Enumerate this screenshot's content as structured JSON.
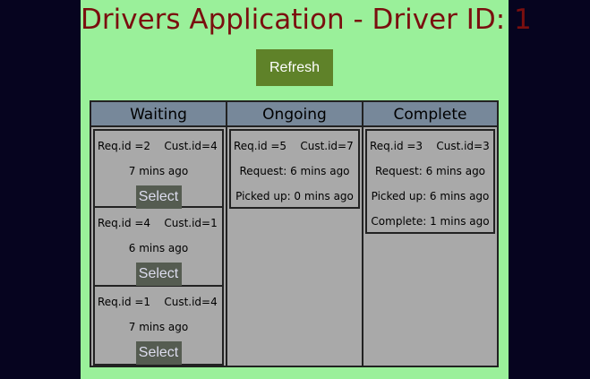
{
  "app": {
    "title": "Drivers Application - Driver ID: 1",
    "refresh_label": "Refresh"
  },
  "columns": {
    "waiting": {
      "header": "Waiting",
      "cards": [
        {
          "req": "Req.id =2",
          "cust": "Cust.id=4",
          "time": "7 mins ago",
          "select_label": "Select"
        },
        {
          "req": "Req.id =4",
          "cust": "Cust.id=1",
          "time": "6 mins ago",
          "select_label": "Select"
        },
        {
          "req": "Req.id =1",
          "cust": "Cust.id=4",
          "time": "7 mins ago",
          "select_label": "Select"
        }
      ]
    },
    "ongoing": {
      "header": "Ongoing",
      "cards": [
        {
          "req": "Req.id =5",
          "cust": "Cust.id=7",
          "request": "Request: 6 mins ago",
          "picked": "Picked up: 0 mins ago"
        }
      ]
    },
    "complete": {
      "header": "Complete",
      "cards": [
        {
          "req": "Req.id =3",
          "cust": "Cust.id=3",
          "request": "Request: 6 mins ago",
          "picked": "Picked up: 6 mins ago",
          "complete": "Complete: 1 mins ago"
        }
      ]
    }
  },
  "colors": {
    "page_bg": "#9af09a",
    "outer_bg": "#06041f",
    "title": "#7a0f0f",
    "refresh_bg": "#5f8229",
    "header_bg": "#77889a",
    "column_bg": "#a9a9a9",
    "select_bg": "#555c51"
  }
}
